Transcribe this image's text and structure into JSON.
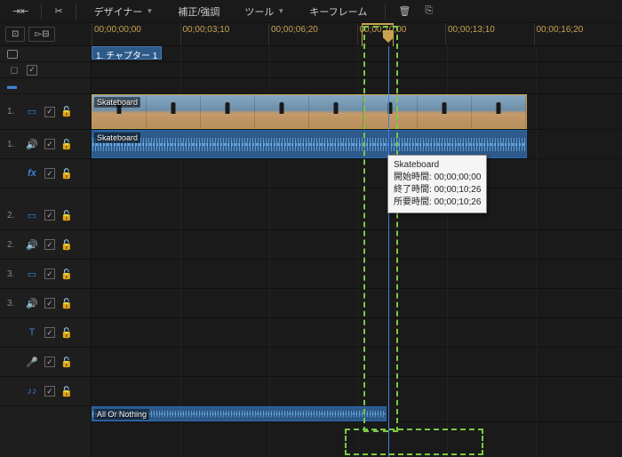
{
  "toolbar": {
    "menu1": "デザイナー",
    "menu2": "補正/強調",
    "menu3": "ツール",
    "menu4": "キーフレーム"
  },
  "ruler": {
    "ticks": [
      "00;00;00;00",
      "00;00;03;10",
      "00;00;06;20",
      "00;00;10;00",
      "00;00;13;10",
      "00;00;16;20"
    ]
  },
  "chapter": {
    "label": "1. チャプター 1"
  },
  "tracks": [
    {
      "num": "1.",
      "type": "video"
    },
    {
      "num": "1.",
      "type": "audio"
    },
    {
      "num": "",
      "type": "fx"
    },
    {
      "num": "2.",
      "type": "video"
    },
    {
      "num": "2.",
      "type": "audio"
    },
    {
      "num": "3.",
      "type": "video"
    },
    {
      "num": "3.",
      "type": "audio"
    },
    {
      "num": "",
      "type": "text"
    },
    {
      "num": "",
      "type": "mic"
    },
    {
      "num": "",
      "type": "music"
    }
  ],
  "clips": {
    "video1": "Skateboard",
    "audio1": "Skateboard",
    "music1": "All Or Nothing"
  },
  "tooltip": {
    "title": "Skateboard",
    "start_label": "開始時間:",
    "start_value": "00;00;00;00",
    "end_label": "終了時間:",
    "end_value": "00;00;10;26",
    "dur_label": "所要時間:",
    "dur_value": "00;00;10;26"
  }
}
